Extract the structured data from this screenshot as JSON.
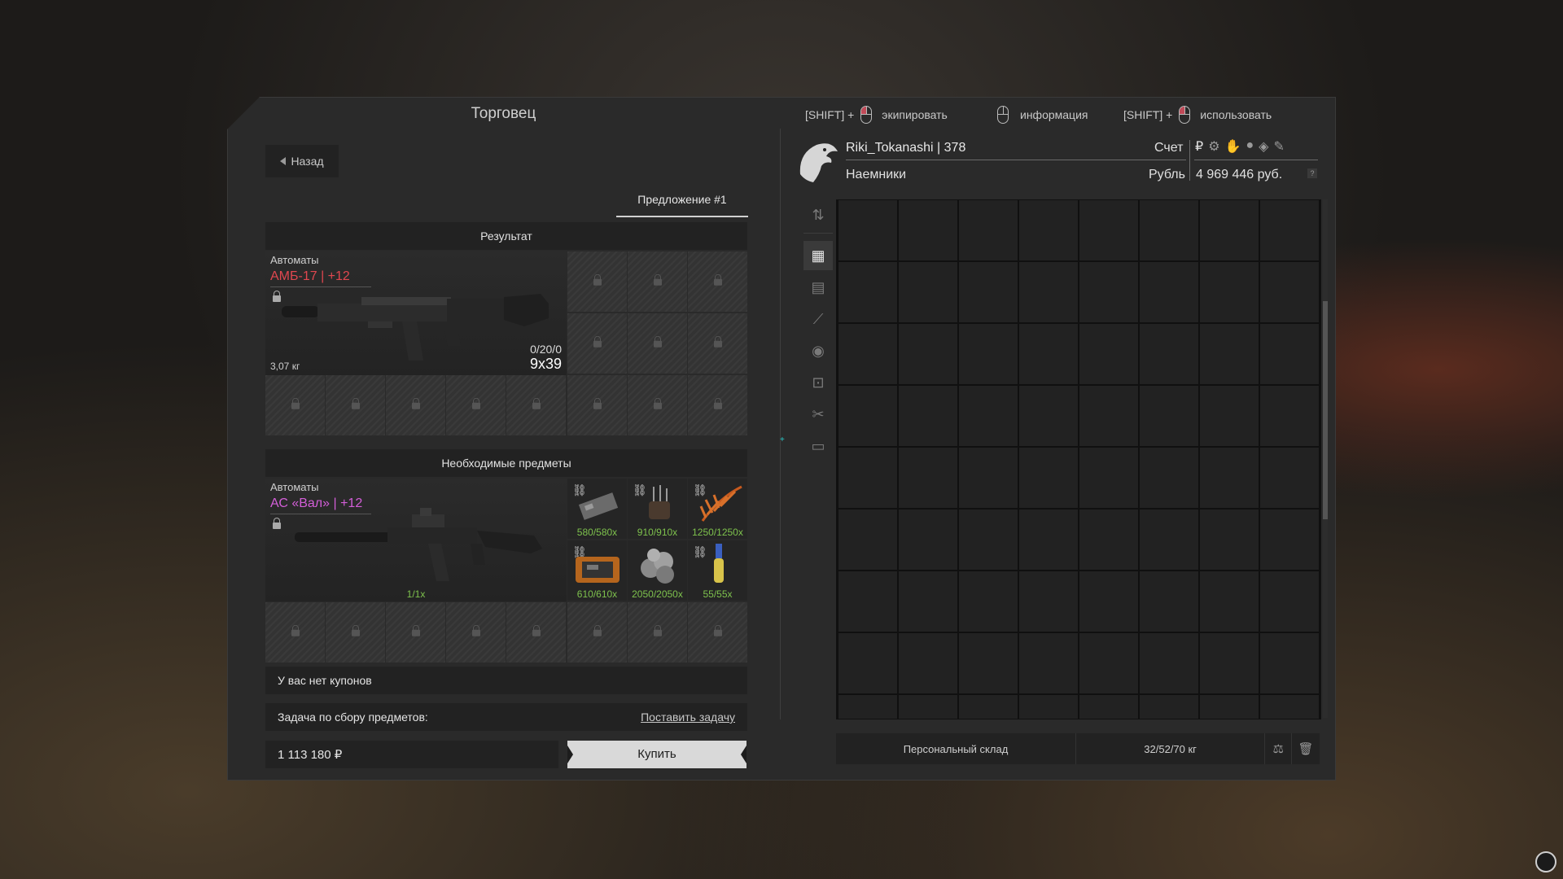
{
  "window": {
    "title": "Торговец"
  },
  "hints": [
    {
      "prefix": "[SHIFT] +",
      "label": "экипировать"
    },
    {
      "prefix": "",
      "label": "информация"
    },
    {
      "prefix": "[SHIFT] +",
      "label": "использовать"
    }
  ],
  "back": {
    "label": "Назад"
  },
  "offer_tab": {
    "label": "Предложение #1"
  },
  "result": {
    "heading": "Результат",
    "category": "Автоматы",
    "name": "АМБ-17 | +12",
    "ammo": "0/20/0",
    "caliber": "9x39",
    "weight": "3,07 кг"
  },
  "required": {
    "heading": "Необходимые предметы",
    "category": "Автоматы",
    "name": "АС «Вал» | +12",
    "qty": "1/1x",
    "items": [
      {
        "qty": "580/580x",
        "icon": "detector-icon",
        "color": "#6b6b6b"
      },
      {
        "qty": "910/910x",
        "icon": "component-icon",
        "color": "#5a4a3a"
      },
      {
        "qty": "1250/1250x",
        "icon": "plant-icon",
        "color": "#c85a1e"
      },
      {
        "qty": "610/610x",
        "icon": "device-icon",
        "color": "#b5651d"
      },
      {
        "qty": "2050/2050x",
        "icon": "rocks-icon",
        "color": "#8a8a8a"
      },
      {
        "qty": "55/55x",
        "icon": "flask-icon",
        "color": "#d8c34a"
      }
    ]
  },
  "coupons": {
    "text": "У вас нет купонов"
  },
  "task": {
    "label": "Задача по сбору предметов:",
    "link": "Поставить задачу"
  },
  "price": {
    "value": "1 113 180 ₽"
  },
  "buy": {
    "label": "Купить"
  },
  "player": {
    "name": "Riki_Tokanashi | 378",
    "faction": "Наемники",
    "account_label": "Счет",
    "currency_label": "Рубль",
    "balance": "4 969 446 руб."
  },
  "storage": {
    "name": "Персональный склад",
    "weight": "32/52/70 кг"
  },
  "colors": {
    "accent_red": "#e0474f",
    "accent_pink": "#d35ed8",
    "qty_green": "#7ec24d"
  }
}
